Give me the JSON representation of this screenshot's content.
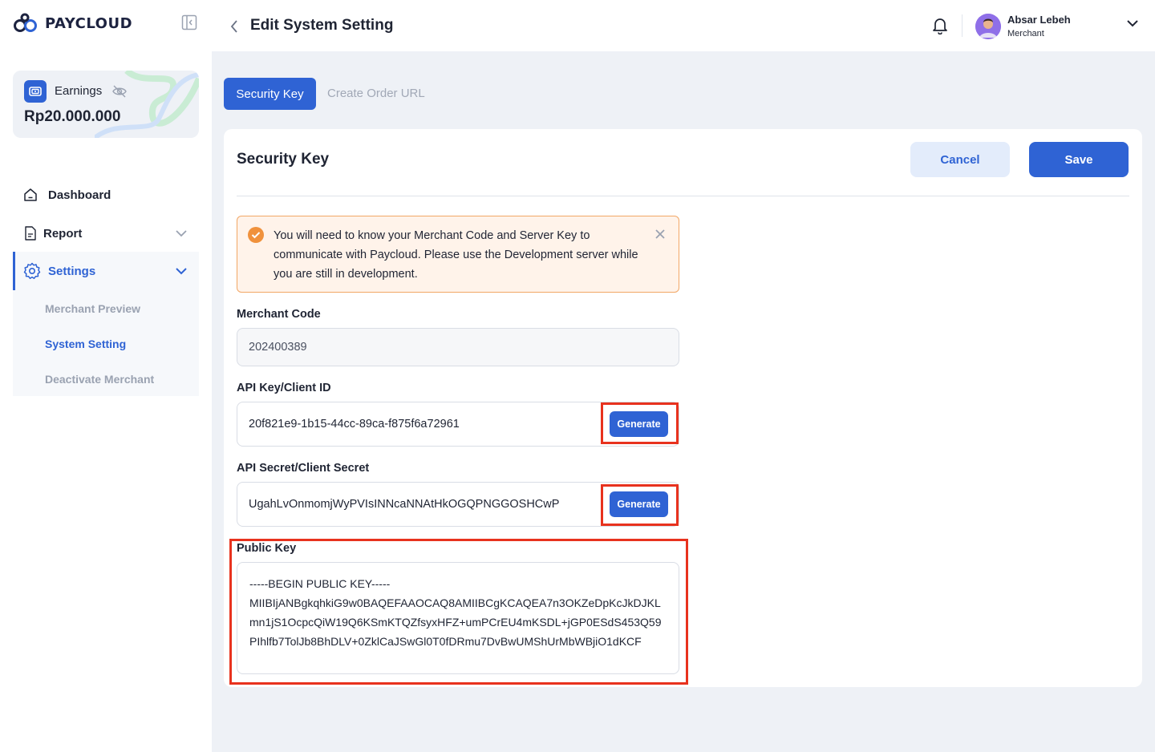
{
  "brand": {
    "name": "PAYCLOUD",
    "logo_icon": "paycloud-logo-icon"
  },
  "earnings": {
    "label": "Earnings",
    "value": "Rp20.000.000"
  },
  "sidebar": {
    "items": [
      {
        "label": "Dashboard",
        "icon": "home-icon"
      },
      {
        "label": "Report",
        "icon": "document-icon"
      },
      {
        "label": "Settings",
        "icon": "gear-icon"
      }
    ],
    "settings_sub": [
      {
        "label": "Merchant Preview"
      },
      {
        "label": "System Setting"
      },
      {
        "label": "Deactivate Merchant"
      }
    ]
  },
  "header": {
    "title": "Edit System Setting",
    "user_name": "Absar Lebeh",
    "user_role": "Merchant"
  },
  "tabs": [
    {
      "label": "Security Key",
      "active": true
    },
    {
      "label": "Create Order URL",
      "active": false
    }
  ],
  "card": {
    "title": "Security Key",
    "cancel_label": "Cancel",
    "save_label": "Save",
    "alert": "You will need to know your Merchant Code and Server Key to communicate with Paycloud. Please use the Development server while you are still in development."
  },
  "fields": {
    "merchant_code": {
      "label": "Merchant Code",
      "value": "202400389"
    },
    "api_key": {
      "label": "API Key/Client ID",
      "value": "20f821e9-1b15-44cc-89ca-f875f6a72961",
      "button": "Generate"
    },
    "api_secret": {
      "label": "API Secret/Client Secret",
      "value": "UgahLvOnmomjWyPVIsINNcaNNAtHkOGQPNGGOSHCwP",
      "button": "Generate"
    },
    "public_key": {
      "label": "Public Key",
      "lines": [
        "-----BEGIN PUBLIC KEY-----",
        "MIIBIjANBgkqhkiG9w0BAQEFAAOCAQ8AMIIBCgKCAQEA7n3OKZeDpKcJkDJKL",
        "mn1jS1OcpcQiW19Q6KSmKTQZfsyxHFZ+umPCrEU4mKSDL+jGP0ESdS453Q59",
        "PIhlfb7TolJb8BhDLV+0ZklCaJSwGl0T0fDRmu7DvBwUMShUrMbWBjiO1dKCF"
      ]
    }
  },
  "colors": {
    "primary": "#2f63d4",
    "alert_bg": "#fff3ea",
    "alert_border": "#f2a766",
    "highlight": "#e8321e"
  }
}
